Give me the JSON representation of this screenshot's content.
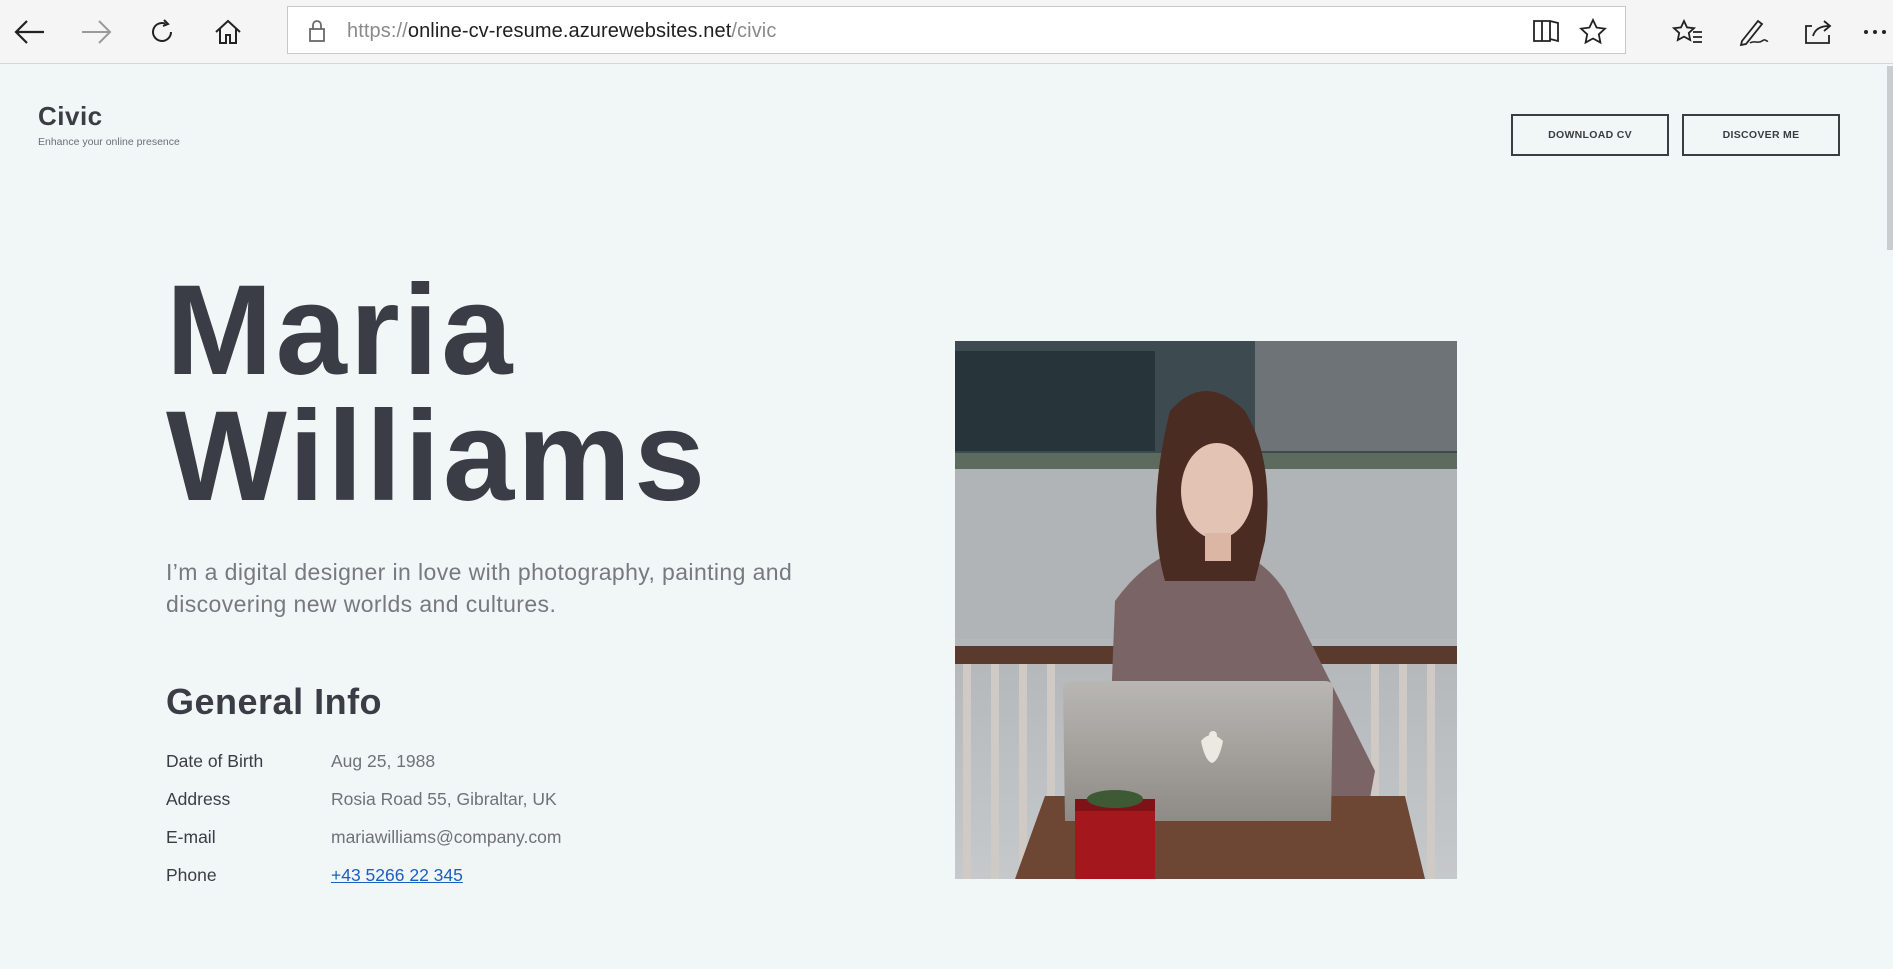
{
  "browser": {
    "url_scheme": "https://",
    "url_host": "online-cv-resume.azurewebsites.net",
    "url_path": "/civic",
    "icons": [
      "back-icon",
      "forward-icon",
      "refresh-icon",
      "home-icon",
      "lock-icon",
      "reading-view-icon",
      "favorite-star-icon",
      "favorites-list-icon",
      "pen-icon",
      "share-icon",
      "more-icon"
    ]
  },
  "header": {
    "brand": "Civic",
    "tagline": "Enhance your online presence",
    "download_label": "DOWNLOAD CV",
    "discover_label": "DISCOVER ME"
  },
  "hero": {
    "first_name": "Maria",
    "last_name": "Williams",
    "intro": "I’m a digital designer in love with photography, painting and discovering new worlds and cultures."
  },
  "general_info": {
    "title": "General Info",
    "rows": [
      {
        "label": "Date of Birth",
        "value": "Aug 25, 1988"
      },
      {
        "label": "Address",
        "value": "Rosia Road 55, Gibraltar, UK"
      },
      {
        "label": "E-mail",
        "value": "mariawilliams@company.com"
      },
      {
        "label": "Phone",
        "value": "+43 5266 22 345"
      }
    ]
  },
  "colors": {
    "page_bg": "#f1f6f6",
    "text_dark": "#3a3d45",
    "text_muted": "#76797e",
    "link": "#1a5fc2"
  }
}
